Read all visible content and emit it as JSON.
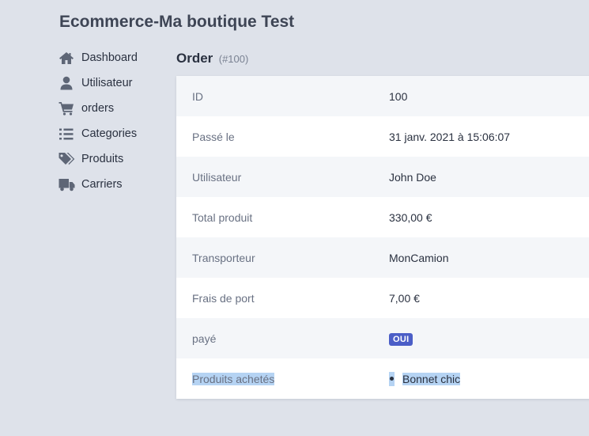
{
  "app": {
    "title": "Ecommerce-Ma boutique Test"
  },
  "sidebar": {
    "items": [
      {
        "label": "Dashboard",
        "icon": "home-icon"
      },
      {
        "label": "Utilisateur",
        "icon": "user-icon"
      },
      {
        "label": "orders",
        "icon": "shopping-cart-icon"
      },
      {
        "label": "Categories",
        "icon": "list-icon"
      },
      {
        "label": "Produits",
        "icon": "tags-icon"
      },
      {
        "label": "Carriers",
        "icon": "truck-icon"
      }
    ]
  },
  "page": {
    "title": "Order",
    "subtitle": "(#100)"
  },
  "order": {
    "rows": [
      {
        "label": "ID",
        "value": "100"
      },
      {
        "label": "Passé le",
        "value": "31 janv. 2021 à 15:06:07"
      },
      {
        "label": "Utilisateur",
        "value": "John Doe"
      },
      {
        "label": "Total produit",
        "value": "330,00 €"
      },
      {
        "label": "Transporteur",
        "value": "MonCamion"
      },
      {
        "label": "Frais de port",
        "value": "7,00 €"
      }
    ],
    "paid": {
      "label": "payé",
      "badge": "OUI"
    },
    "products": {
      "label": "Produits achetés",
      "items": [
        "Bonnet chic"
      ]
    }
  },
  "colors": {
    "background": "#dee2ea",
    "badge": "#4b5ec7",
    "selection": "#b5d3f3"
  }
}
